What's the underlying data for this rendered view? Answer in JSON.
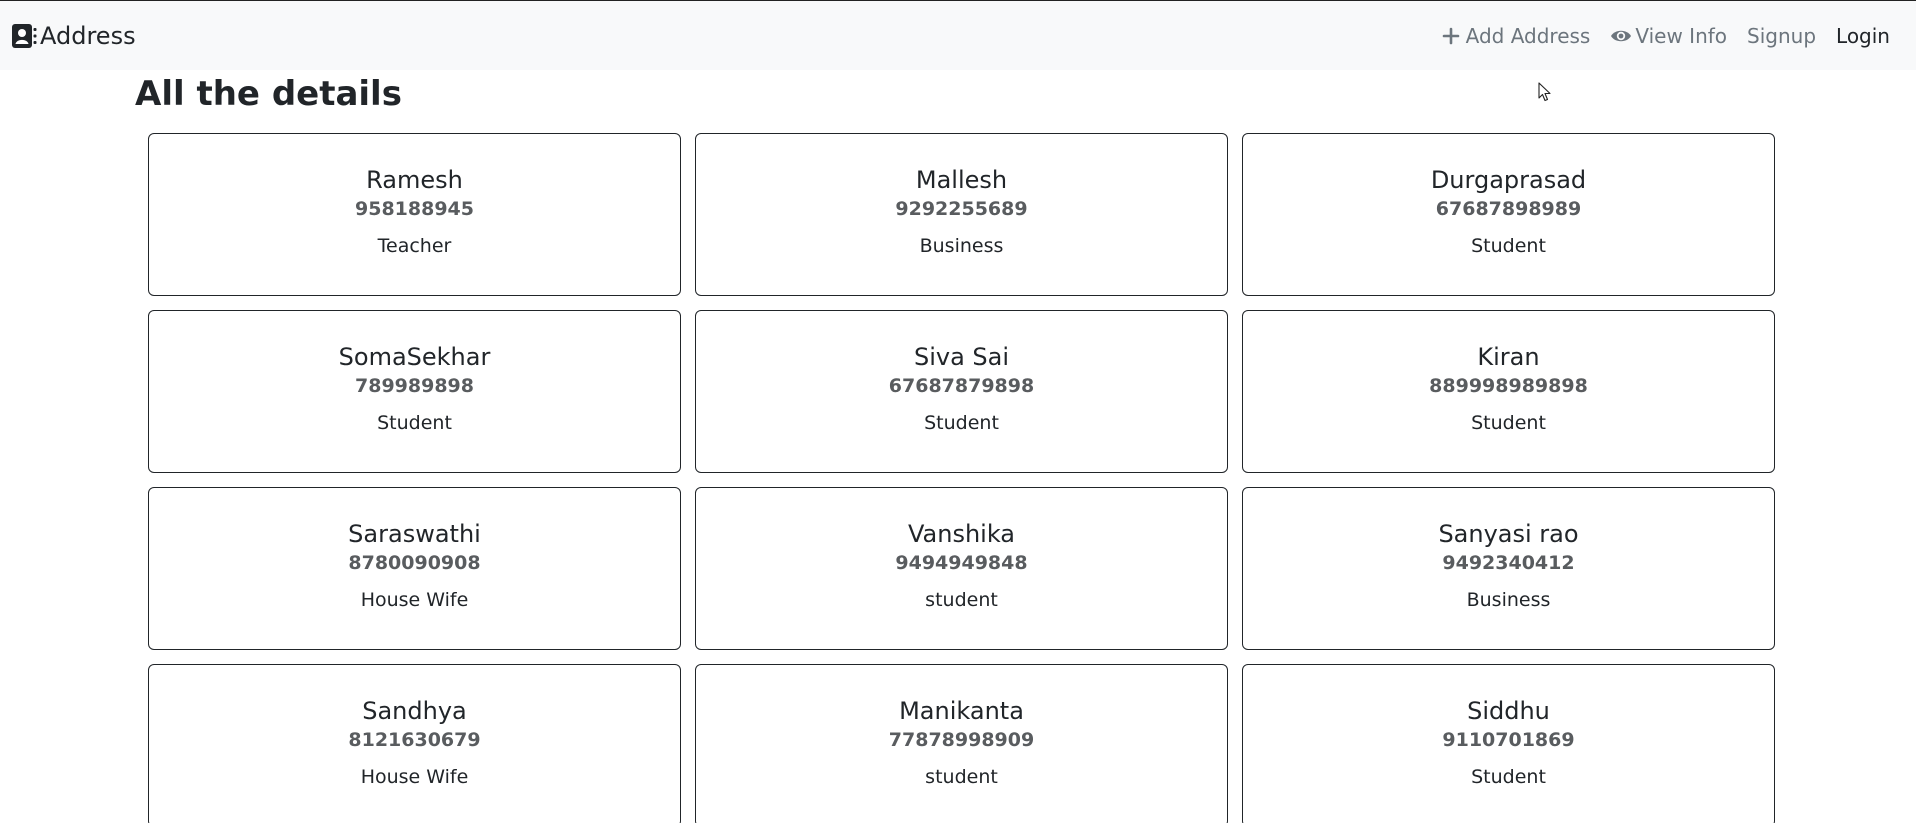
{
  "navbar": {
    "brand_label": "Address",
    "links": [
      {
        "label": "Add Address",
        "icon": "plus-icon"
      },
      {
        "label": "View Info",
        "icon": "eye-icon"
      },
      {
        "label": "Signup",
        "icon": ""
      },
      {
        "label": "Login",
        "icon": ""
      }
    ]
  },
  "main": {
    "heading": "All the details",
    "cards": [
      {
        "name": "Ramesh",
        "phone": "958188945",
        "occupation": "Teacher"
      },
      {
        "name": "Mallesh",
        "phone": "9292255689",
        "occupation": "Business"
      },
      {
        "name": "Durgaprasad",
        "phone": "67687898989",
        "occupation": "Student"
      },
      {
        "name": "SomaSekhar",
        "phone": "789989898",
        "occupation": "Student"
      },
      {
        "name": "Siva Sai",
        "phone": "67687879898",
        "occupation": "Student"
      },
      {
        "name": "Kiran",
        "phone": "889998989898",
        "occupation": "Student"
      },
      {
        "name": "Saraswathi",
        "phone": "8780090908",
        "occupation": "House Wife"
      },
      {
        "name": "Vanshika",
        "phone": "9494949848",
        "occupation": "student"
      },
      {
        "name": "Sanyasi rao",
        "phone": "9492340412",
        "occupation": "Business"
      },
      {
        "name": "Sandhya",
        "phone": "8121630679",
        "occupation": "House Wife"
      },
      {
        "name": "Manikanta",
        "phone": "77878998909",
        "occupation": "student"
      },
      {
        "name": "Siddhu",
        "phone": "9110701869",
        "occupation": "Student"
      }
    ]
  }
}
